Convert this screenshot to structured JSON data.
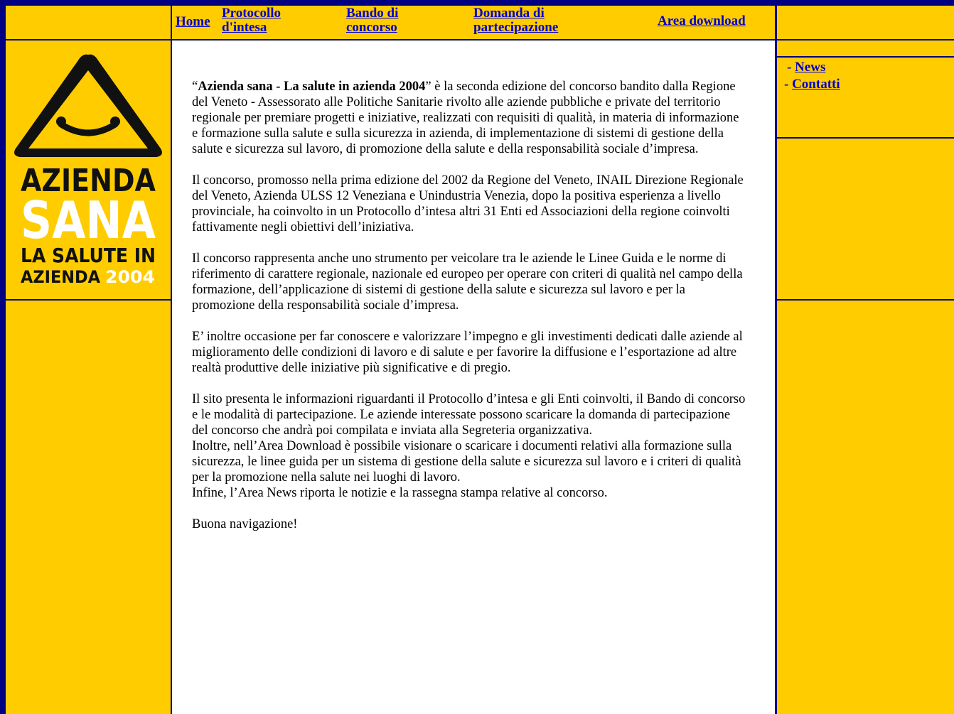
{
  "nav": {
    "home": "Home",
    "protocollo": [
      "Protocollo",
      "d'intesa"
    ],
    "bando": [
      "Bando di",
      "concorso"
    ],
    "domanda": [
      "Domanda di",
      "partecipazione"
    ],
    "download": "Area download"
  },
  "side": {
    "news_prefix": "-",
    "news": "News",
    "contatti_prefix": "-",
    "contatti": "Contatti"
  },
  "logo": {
    "line1": "AZIENDA",
    "line2": "SANA",
    "line3": "LA SALUTE IN",
    "line4a": "AZIENDA",
    "line4b": "2004",
    "icon": "smiley-warning-triangle-icon"
  },
  "content": {
    "p1_open_quote": "“",
    "p1_bold": "Azienda sana - La salute in azienda 2004",
    "p1_rest": "” è la seconda edizione del concorso bandito dalla Regione del Veneto - Assessorato alle Politiche Sanitarie rivolto alle aziende pubbliche e private del territorio regionale per premiare progetti e iniziative, realizzati con requisiti di qualità, in materia di informazione e formazione sulla salute e sulla sicurezza in azienda, di implementazione di sistemi di gestione della salute e sicurezza sul lavoro, di promozione della salute e della responsabilità sociale d’impresa.",
    "p2": "Il concorso, promosso nella prima edizione del 2002 da Regione del Veneto, INAIL Direzione Regionale del Veneto, Azienda ULSS 12 Veneziana e Unindustria Venezia, dopo la positiva esperienza a livello provinciale, ha coinvolto in un Protocollo d’intesa altri 31 Enti ed Associazioni della regione coinvolti fattivamente negli obiettivi dell’iniziativa.",
    "p3": "Il concorso rappresenta anche uno strumento per veicolare tra le aziende le Linee Guida e le norme di riferimento di carattere regionale, nazionale ed europeo per operare con criteri di qualità nel campo della formazione, dell’applicazione di sistemi di gestione della salute e sicurezza sul lavoro e per la promozione della responsabilità sociale d’impresa.",
    "p4": "E’ inoltre occasione per far conoscere e valorizzare l’impegno e gli investimenti dedicati dalle aziende al miglioramento delle condizioni di lavoro e di salute e per favorire la diffusione e l’esportazione ad altre realtà produttive delle iniziative più significative e di pregio.",
    "p5a": "Il sito presenta le informazioni riguardanti il Protocollo d’intesa e gli Enti coinvolti, il Bando di concorso e le modalità di partecipazione. Le aziende interessate possono scaricare la domanda di partecipazione del concorso che andrà poi compilata e inviata alla Segreteria organizzativa.",
    "p5b": "Inoltre, nell’Area Download è possibile visionare o scaricare i documenti relativi alla formazione sulla sicurezza, le linee guida per un sistema di gestione della salute e sicurezza sul lavoro e i criteri di qualità per la promozione nella salute nei luoghi di lavoro.",
    "p5c": "Infine, l’Area News riporta le notizie e la rassegna stampa relative al concorso.",
    "p6": "Buona navigazione!"
  },
  "colors": {
    "background": "#000080",
    "panel": "#ffcc00",
    "link": "#0000cc",
    "content_bg": "#ffffff"
  }
}
